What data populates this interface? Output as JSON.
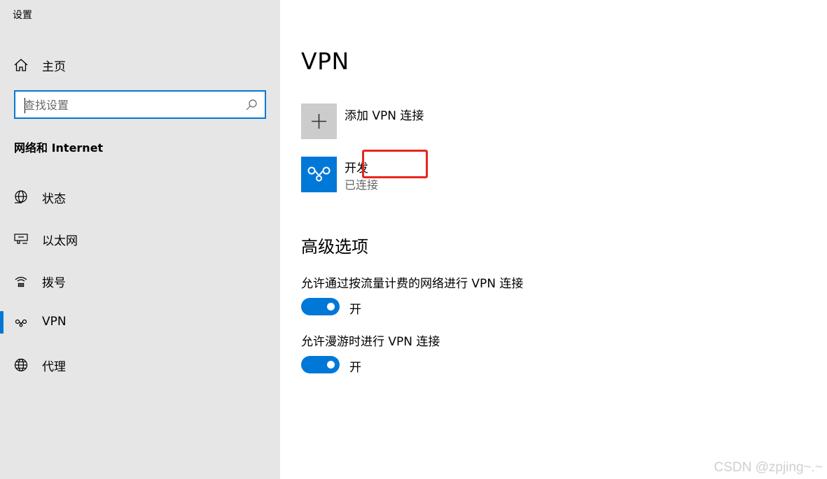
{
  "window": {
    "title": "设置"
  },
  "sidebar": {
    "home_label": "主页",
    "search_placeholder": "查找设置",
    "section_heading": "网络和 Internet",
    "items": [
      {
        "label": "状态",
        "icon": "globe-status-icon"
      },
      {
        "label": "以太网",
        "icon": "ethernet-icon"
      },
      {
        "label": "拨号",
        "icon": "dialup-icon"
      },
      {
        "label": "VPN",
        "icon": "vpn-icon",
        "selected": true
      },
      {
        "label": "代理",
        "icon": "globe-icon"
      }
    ]
  },
  "main": {
    "title": "VPN",
    "add_vpn_label": "添加 VPN 连接",
    "connection": {
      "name": "开发",
      "status": "已连接"
    },
    "advanced": {
      "title": "高级选项",
      "options": [
        {
          "label": "允许通过按流量计费的网络进行 VPN 连接",
          "state": "开"
        },
        {
          "label": "允许漫游时进行 VPN 连接",
          "state": "开"
        }
      ]
    }
  },
  "watermark": "CSDN @zpjing~.~",
  "colors": {
    "accent": "#0078d7",
    "sidebar_bg": "#e6e6e6",
    "highlight": "#e8251f",
    "tile_gray": "#cccccc"
  }
}
